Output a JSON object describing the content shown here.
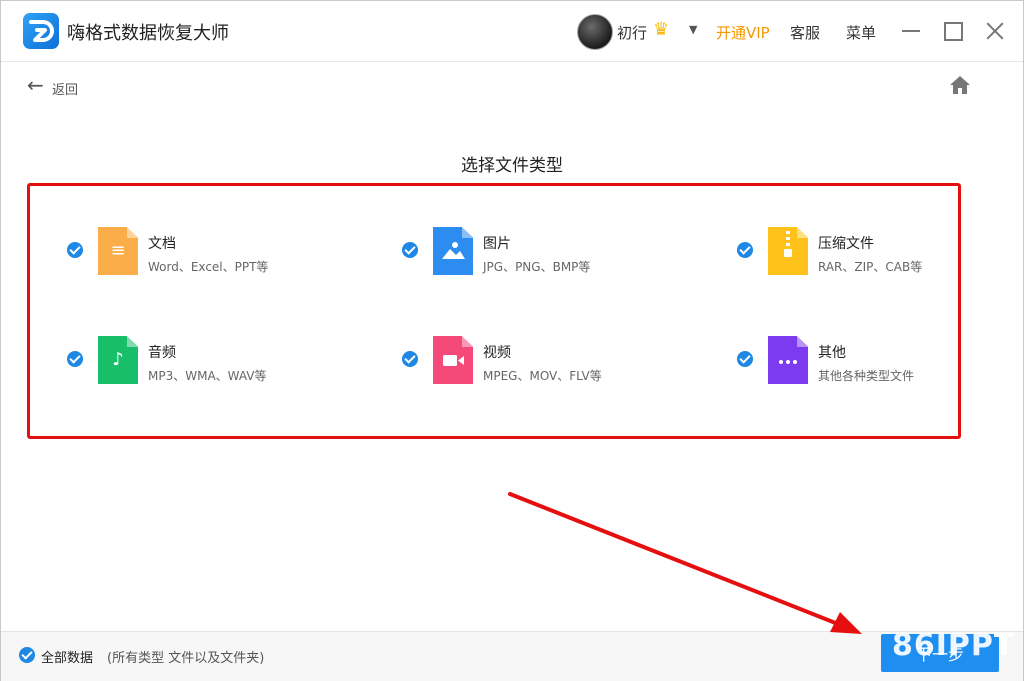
{
  "app": {
    "title": "嗨格式数据恢复大师",
    "username": "初行"
  },
  "header": {
    "vip_label": "开通VIP",
    "service_label": "客服",
    "menu_label": "菜单"
  },
  "nav": {
    "back_label": "返回"
  },
  "section_title": "选择文件类型",
  "file_types": [
    {
      "name": "文档",
      "desc": "Word、Excel、PPT等",
      "color": "#fbad4a",
      "icon": "document-icon"
    },
    {
      "name": "图片",
      "desc": "JPG、PNG、BMP等",
      "color": "#2d8cf0",
      "icon": "image-icon"
    },
    {
      "name": "压缩文件",
      "desc": "RAR、ZIP、CAB等",
      "color": "#ffc21a",
      "icon": "archive-icon"
    },
    {
      "name": "音频",
      "desc": "MP3、WMA、WAV等",
      "color": "#19be6b",
      "icon": "music-icon"
    },
    {
      "name": "视频",
      "desc": "MPEG、MOV、FLV等",
      "color": "#f5497a",
      "icon": "video-icon"
    },
    {
      "name": "其他",
      "desc": "其他各种类型文件",
      "color": "#7c3bee",
      "icon": "more-icon"
    }
  ],
  "footer": {
    "all_label": "全部数据",
    "all_desc": "(所有类型 文件以及文件夹)",
    "next_label": "下一步"
  },
  "watermark": "86IPPT",
  "colors": {
    "accent": "#1e8ff0",
    "vip": "#f39800",
    "highlight": "#e60f0f"
  }
}
